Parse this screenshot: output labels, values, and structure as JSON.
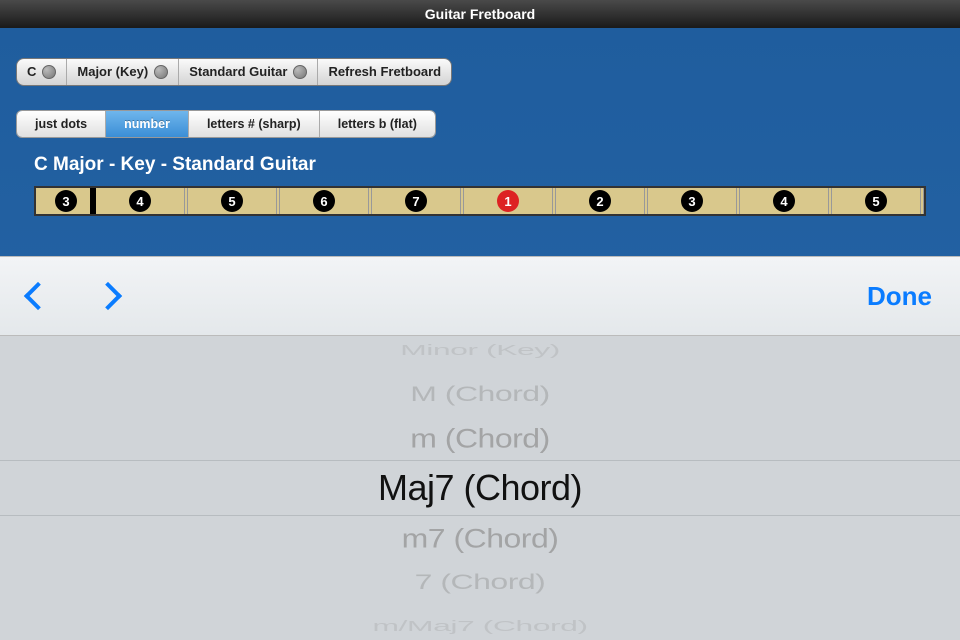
{
  "titlebar": {
    "title": "Guitar Fretboard"
  },
  "toolbar": {
    "note_btn": "C",
    "mode_btn": "Major (Key)",
    "tuning_btn": "Standard Guitar",
    "refresh_btn": "Refresh Fretboard"
  },
  "display_mode": {
    "tabs": [
      "just dots",
      "number",
      "letters # (sharp)",
      "letters b (flat)"
    ],
    "selected_index": 1
  },
  "heading": "C Major - Key - Standard Guitar",
  "fretboard": {
    "markers": [
      {
        "label": "3",
        "color": "black"
      },
      {
        "label": "4",
        "color": "black"
      },
      {
        "label": "5",
        "color": "black"
      },
      {
        "label": "6",
        "color": "black"
      },
      {
        "label": "7",
        "color": "black"
      },
      {
        "label": "1",
        "color": "red"
      },
      {
        "label": "2",
        "color": "black"
      },
      {
        "label": "3",
        "color": "black"
      },
      {
        "label": "4",
        "color": "black"
      },
      {
        "label": "5",
        "color": "black"
      }
    ]
  },
  "picker": {
    "done_label": "Done",
    "options": [
      "Minor (Key)",
      "M (Chord)",
      "m (Chord)",
      "Maj7 (Chord)",
      "m7 (Chord)",
      "7 (Chord)",
      "m/Maj7 (Chord)"
    ],
    "selected_index": 3
  }
}
